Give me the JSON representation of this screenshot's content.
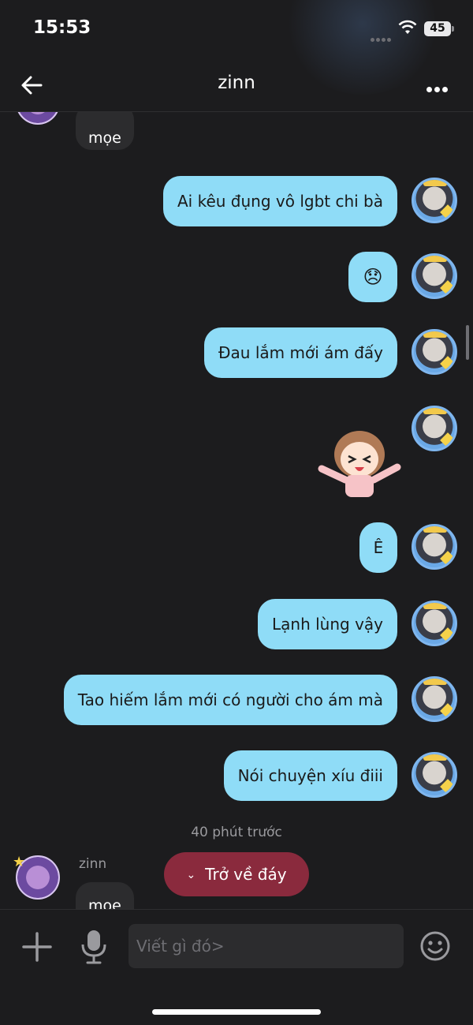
{
  "status_bar": {
    "time": "15:53",
    "battery": "45"
  },
  "header": {
    "title": "zinn"
  },
  "messages": {
    "top_incoming": "mọe",
    "outgoing": [
      "Ai kêu đụng vô lgbt chi bà",
      "😞",
      "Đau lắm mới ám đấy",
      "Ê",
      "Lạnh lùng vậy",
      "Tao hiếm lắm mới có người cho ám mà",
      "Nói chuyện xíu điii"
    ],
    "timestamp": "40 phút trước",
    "sender_name": "zinn",
    "bottom_incoming": "mọe"
  },
  "jump_button": {
    "label": "Trở về đáy"
  },
  "composer": {
    "placeholder": "Viết gì đó>"
  },
  "colors": {
    "outgoing_bubble": "#8fdcf7",
    "incoming_bubble": "#2c2c2e",
    "jump_button": "#8a2a3d",
    "background": "#1c1c1e"
  }
}
